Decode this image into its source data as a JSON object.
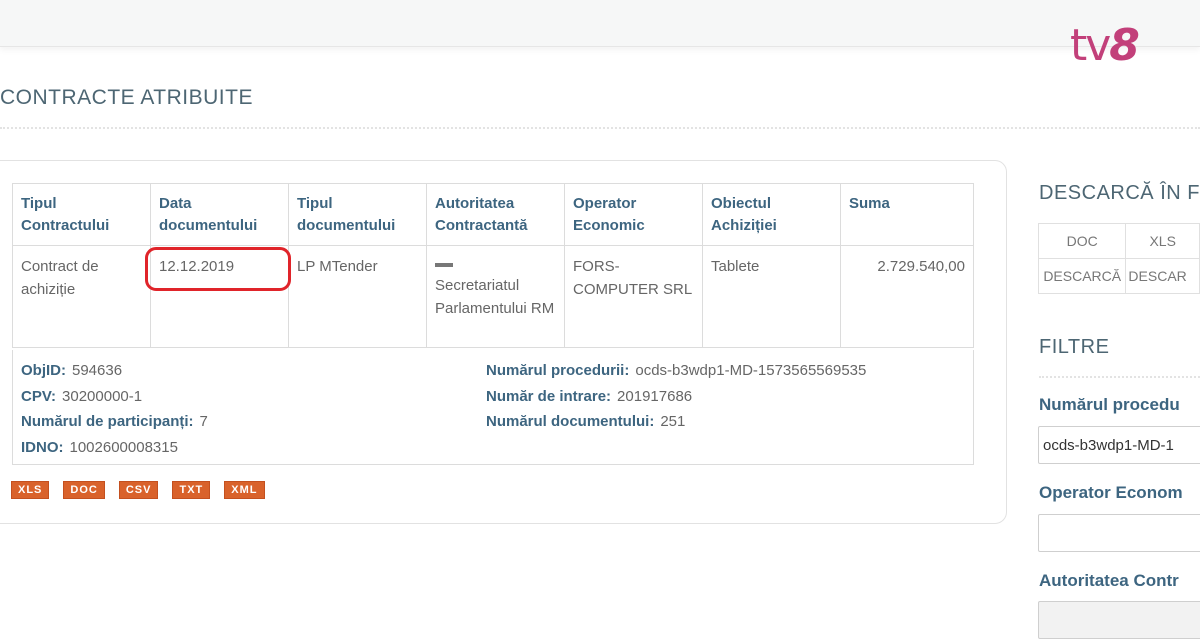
{
  "branding": {
    "logo_tv": "tv",
    "logo_8": "8"
  },
  "page": {
    "title": "CONTRACTE ATRIBUITE"
  },
  "table": {
    "headers": [
      "Tipul Contractului",
      "Data documentului",
      "Tipul documentului",
      "Autoritatea Contractantă",
      "Operator Economic",
      "Obiectul Achiziției",
      "Suma"
    ],
    "row": {
      "contract_type": "Contract de achiziție",
      "document_date": "12.12.2019",
      "document_type": "LP MTender",
      "authority": "Secretariatul Parlamentului RM",
      "operator": "FORS-COMPUTER SRL",
      "object": "Tablete",
      "amount": "2.729.540,00"
    }
  },
  "details": {
    "left": [
      {
        "label": "ObjID:",
        "value": "594636"
      },
      {
        "label": "CPV:",
        "value": "30200000-1"
      },
      {
        "label": "Numărul de participanți:",
        "value": "7"
      },
      {
        "label": "IDNO:",
        "value": "1002600008315"
      }
    ],
    "right": [
      {
        "label": "Numărul procedurii:",
        "value": "ocds-b3wdp1-MD-1573565569535"
      },
      {
        "label": "Număr de intrare:",
        "value": "201917686"
      },
      {
        "label": "Numărul documentului:",
        "value": "251"
      }
    ]
  },
  "export_buttons": [
    "XLS",
    "DOC",
    "CSV",
    "TXT",
    "XML"
  ],
  "sidebar": {
    "download_title": "DESCARCĂ ÎN F",
    "download_formats": [
      "DOC",
      "XLS"
    ],
    "download_action": "DESCARCĂ",
    "download_action_cut": "DESCAR",
    "filters_title": "FILTRE",
    "filters": [
      {
        "label": "Numărul procedu",
        "value": "ocds-b3wdp1-MD-1"
      },
      {
        "label": "Operator Econom",
        "value": ""
      },
      {
        "label": "Autoritatea Contr",
        "value": ""
      }
    ]
  },
  "colors": {
    "accent": "#3d6580",
    "export": "#d9622b",
    "highlight": "#e0242a",
    "logo": "#c2407a"
  }
}
